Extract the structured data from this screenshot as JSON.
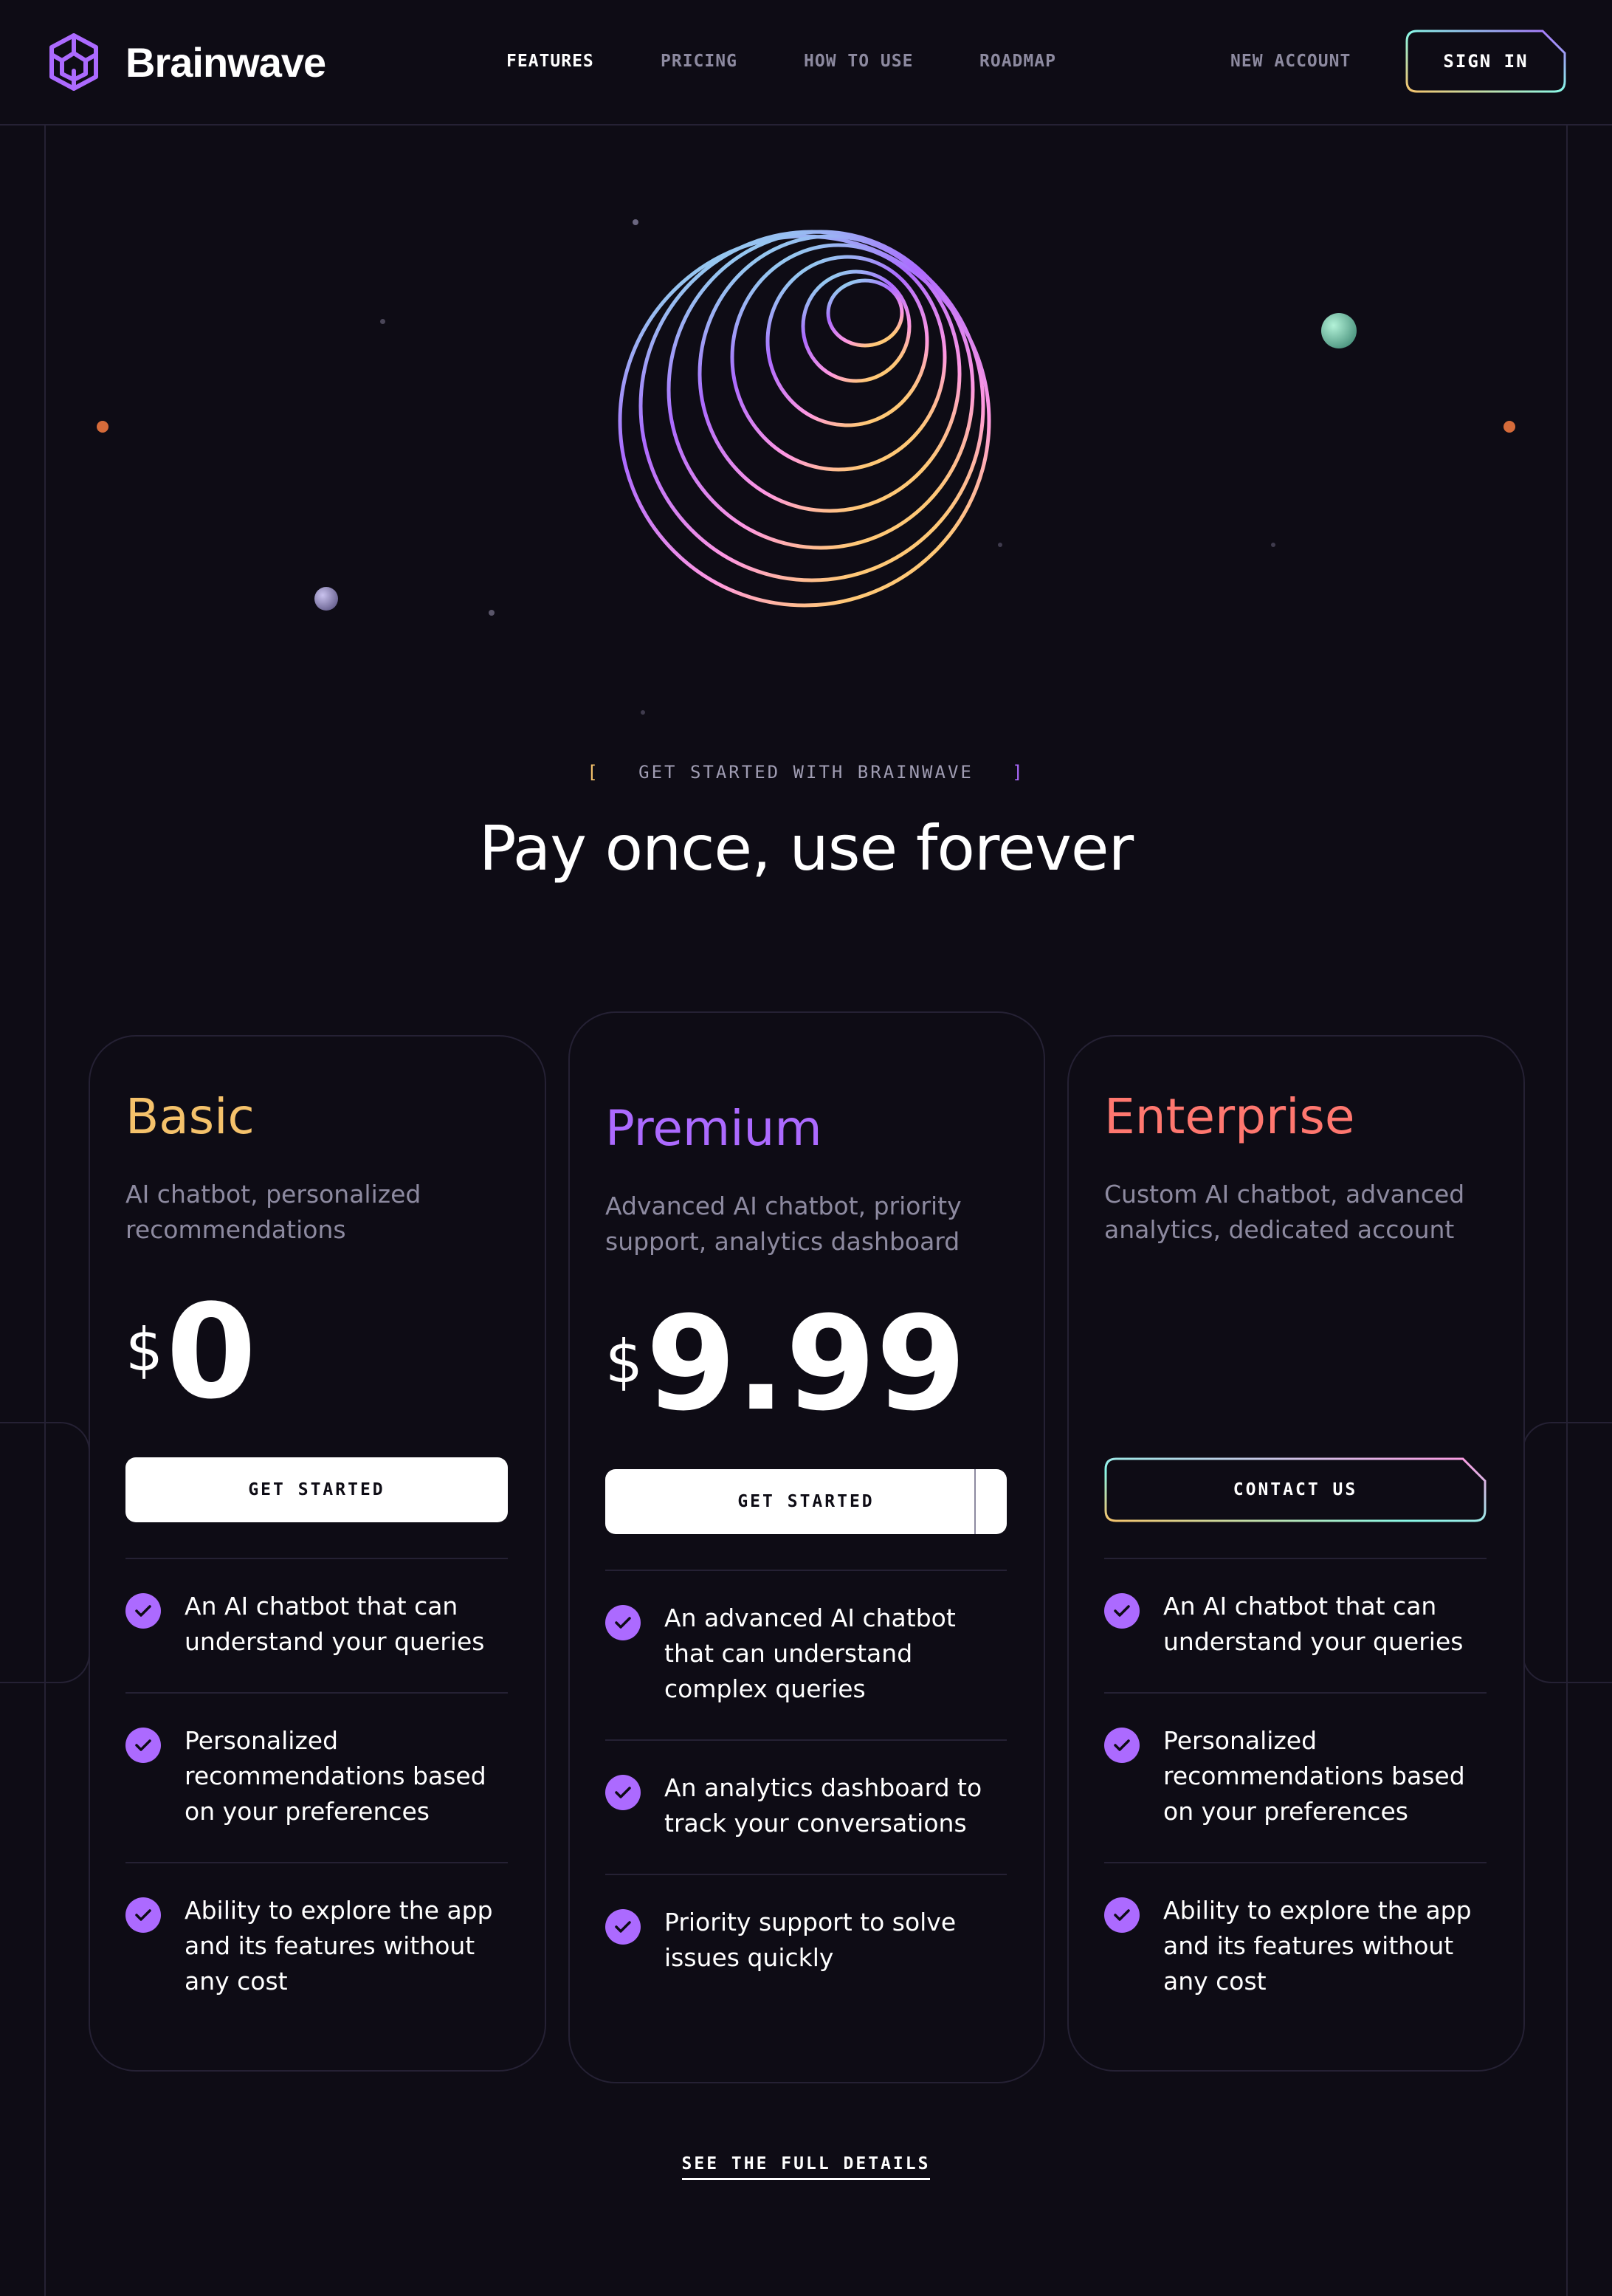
{
  "header": {
    "brand": "Brainwave",
    "nav": [
      {
        "label": "FEATURES",
        "active": true
      },
      {
        "label": "PRICING",
        "active": false
      },
      {
        "label": "HOW TO USE",
        "active": false
      },
      {
        "label": "ROADMAP",
        "active": false
      }
    ],
    "new_account": "NEW ACCOUNT",
    "sign_in": "SIGN IN"
  },
  "hero": {
    "eyebrow": "GET STARTED WITH BRAINWAVE",
    "bracket_open": "[",
    "bracket_close": "]",
    "title": "Pay once, use forever"
  },
  "plans": [
    {
      "name": "Basic",
      "name_color": "#f5c26b",
      "description": "AI chatbot, personalized recommendations",
      "currency": "$",
      "price": "0",
      "cta": "GET STARTED",
      "features": [
        "An AI chatbot that can understand your queries",
        "Personalized recommendations based on your preferences",
        "Ability to explore the app and its features without any cost"
      ]
    },
    {
      "name": "Premium",
      "name_color": "#ac6aff",
      "description": "Advanced AI chatbot, priority support, analytics dashboard",
      "currency": "$",
      "price": "9.99",
      "cta": "GET STARTED",
      "features": [
        "An advanced AI chatbot that can understand complex queries",
        "An analytics dashboard to track your conversations",
        "Priority support to solve issues quickly"
      ]
    },
    {
      "name": "Enterprise",
      "name_color": "#ff776f",
      "description": "Custom AI chatbot, advanced analytics, dedicated account",
      "currency": "",
      "price": "",
      "cta": "CONTACT US",
      "features": [
        "An AI chatbot that can understand your queries",
        "Personalized recommendations based on your preferences",
        "Ability to explore the app and its features without any cost"
      ]
    }
  ],
  "footer_link": "SEE THE FULL DETAILS",
  "colors": {
    "background": "#0e0c15",
    "accent": "#ac6aff",
    "stroke": "#252134"
  }
}
